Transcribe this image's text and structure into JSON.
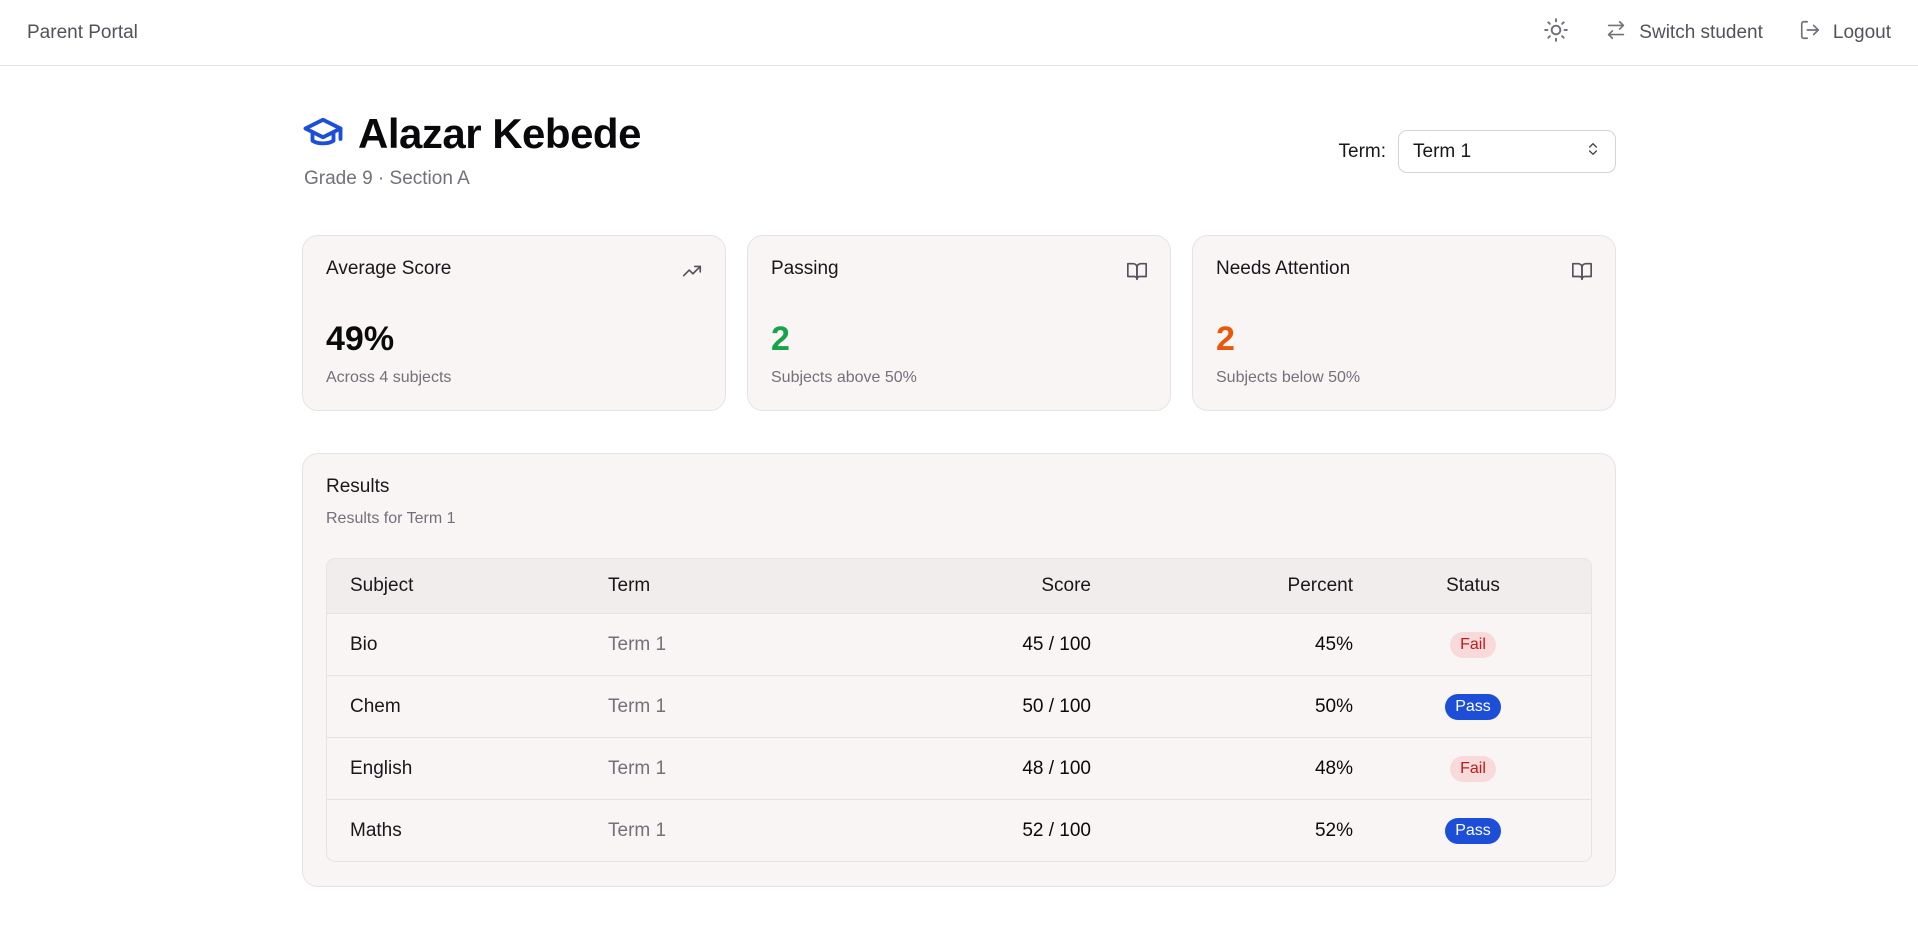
{
  "topbar": {
    "brand": "Parent Portal",
    "switch_label": "Switch student",
    "logout_label": "Logout",
    "icons": [
      "sun-icon",
      "switch-arrows-icon",
      "logout-icon"
    ]
  },
  "student": {
    "name": "Alazar Kebede",
    "meta": "Grade 9 · Section A",
    "icon": "graduation-cap-icon",
    "accent_color": "#1d4ed8"
  },
  "term_picker": {
    "label": "Term:",
    "selected": "Term 1"
  },
  "cards": [
    {
      "title": "Average Score",
      "value": "49%",
      "sub": "Across 4 subjects",
      "icon": "trending-up-icon",
      "value_color": "#0a0a0a"
    },
    {
      "title": "Passing",
      "value": "2",
      "sub": "Subjects above 50%",
      "icon": "book-open-icon",
      "value_color": "#16a34a"
    },
    {
      "title": "Needs Attention",
      "value": "2",
      "sub": "Subjects below 50%",
      "icon": "book-open-icon",
      "value_color": "#ea580c"
    }
  ],
  "results": {
    "title": "Results",
    "subtitle": "Results for Term 1",
    "columns": [
      "Subject",
      "Term",
      "Score",
      "Percent",
      "Status"
    ],
    "rows": [
      {
        "subject": "Bio",
        "term": "Term 1",
        "score": "45 / 100",
        "percent": "45%",
        "status": "Fail"
      },
      {
        "subject": "Chem",
        "term": "Term 1",
        "score": "50 / 100",
        "percent": "50%",
        "status": "Pass"
      },
      {
        "subject": "English",
        "term": "Term 1",
        "score": "48 / 100",
        "percent": "48%",
        "status": "Fail"
      },
      {
        "subject": "Maths",
        "term": "Term 1",
        "score": "52 / 100",
        "percent": "52%",
        "status": "Pass"
      }
    ]
  }
}
